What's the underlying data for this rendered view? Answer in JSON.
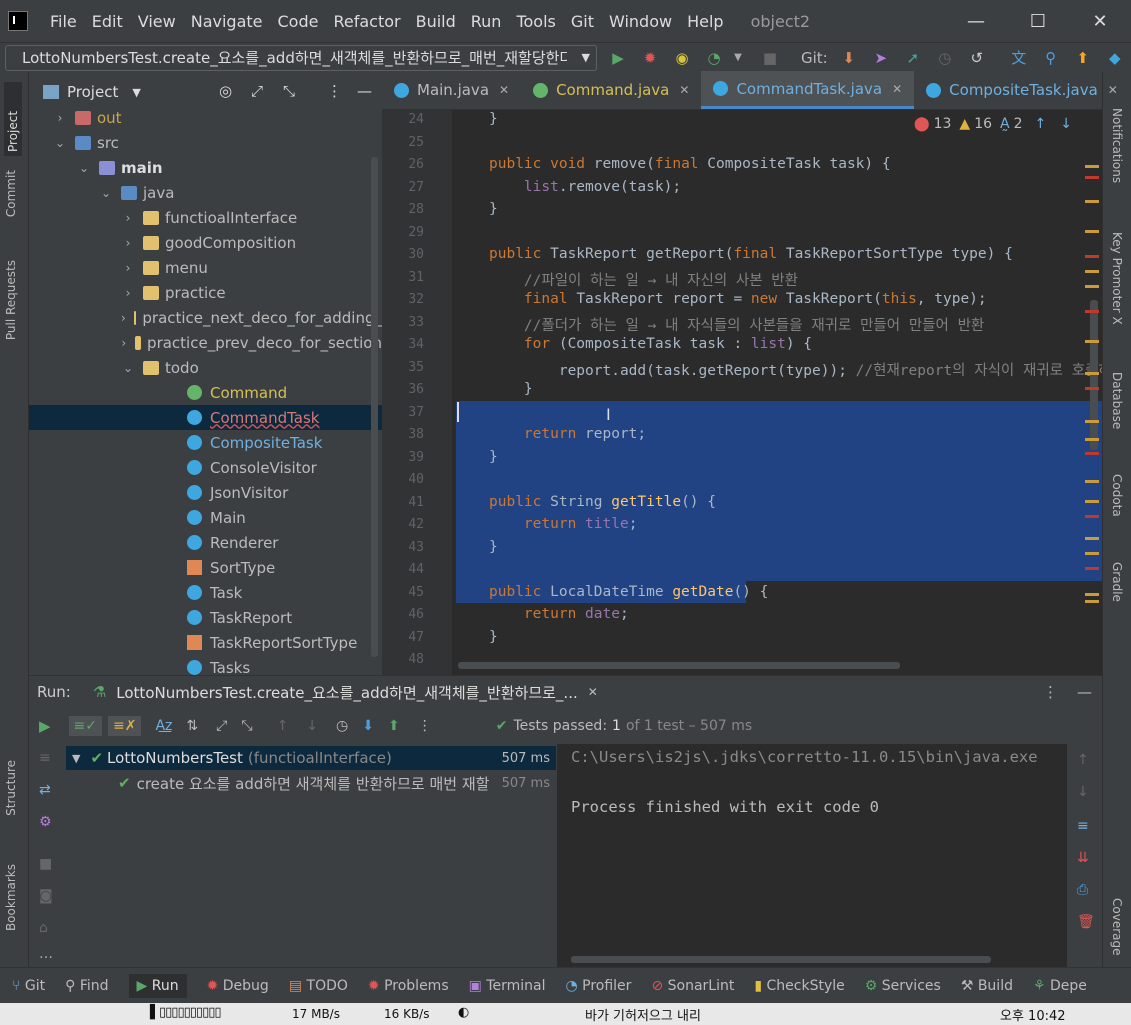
{
  "menubar": {
    "items": [
      "File",
      "Edit",
      "View",
      "Navigate",
      "Code",
      "Refactor",
      "Build",
      "Run",
      "Tools",
      "Git",
      "Window",
      "Help"
    ],
    "project": "object2"
  },
  "toolbar": {
    "run_config": "LottoNumbersTest.create_요소를_add하면_새객체를_반환하므로_매번_재할당한다",
    "git_label": "Git:"
  },
  "left_stripe": {
    "project": "Project",
    "commit": "Commit",
    "pull_requests": "Pull Requests",
    "structure": "Structure",
    "bookmarks": "Bookmarks"
  },
  "right_stripe": {
    "notifications": "Notifications",
    "key_promoter": "Key Promoter X",
    "database": "Database",
    "codota": "Codota",
    "gradle": "Gradle",
    "coverage": "Coverage"
  },
  "project_panel": {
    "title": "Project",
    "tree": [
      {
        "label": "out",
        "type": "folder-out"
      },
      {
        "label": "src",
        "type": "src"
      },
      {
        "label": "main",
        "type": "module"
      },
      {
        "label": "java",
        "type": "src"
      },
      {
        "label": "functioalInterface",
        "type": "folder"
      },
      {
        "label": "goodComposition",
        "type": "folder"
      },
      {
        "label": "menu",
        "type": "folder"
      },
      {
        "label": "practice",
        "type": "folder"
      },
      {
        "label": "practice_next_deco_for_adding_",
        "type": "folder"
      },
      {
        "label": "practice_prev_deco_for_section",
        "type": "folder"
      },
      {
        "label": "todo",
        "type": "folder"
      },
      {
        "label": "Command",
        "type": "interface"
      },
      {
        "label": "CommandTask",
        "type": "class"
      },
      {
        "label": "CompositeTask",
        "type": "class"
      },
      {
        "label": "ConsoleVisitor",
        "type": "class"
      },
      {
        "label": "JsonVisitor",
        "type": "class"
      },
      {
        "label": "Main",
        "type": "class"
      },
      {
        "label": "Renderer",
        "type": "class"
      },
      {
        "label": "SortType",
        "type": "enum"
      },
      {
        "label": "Task",
        "type": "class"
      },
      {
        "label": "TaskReport",
        "type": "class"
      },
      {
        "label": "TaskReportSortType",
        "type": "enum"
      },
      {
        "label": "Tasks",
        "type": "class"
      }
    ]
  },
  "editor": {
    "tabs": [
      {
        "label": "Main.java"
      },
      {
        "label": "Command.java"
      },
      {
        "label": "CommandTask.java"
      },
      {
        "label": "CompositeTask.java"
      }
    ],
    "inspections": {
      "errors": "13",
      "warnings": "16",
      "typos": "2"
    },
    "line_numbers": [
      "24",
      "25",
      "26",
      "27",
      "28",
      "29",
      "30",
      "31",
      "32",
      "33",
      "34",
      "35",
      "36",
      "37",
      "38",
      "39",
      "40",
      "41",
      "42",
      "43",
      "44",
      "45",
      "46",
      "47",
      "48"
    ]
  },
  "run_panel": {
    "label": "Run:",
    "tab": "LottoNumbersTest.create_요소를_add하면_새객체를_반환하므로_...",
    "tests_passed": "Tests passed:",
    "tests_count": "1",
    "tests_detail": "of 1 test – 507 ms",
    "tree": [
      {
        "label": "LottoNumbersTest",
        "sub": "(functioalInterface)",
        "time": "507 ms"
      },
      {
        "label": "create 요소를 add하면 새객체를 반환하므로 매번 재할",
        "sub": "",
        "time": "507 ms"
      }
    ],
    "console": [
      "C:\\Users\\is2js\\.jdks\\corretto-11.0.15\\bin\\java.exe",
      "",
      "Process finished with exit code 0"
    ]
  },
  "bottom_bar": [
    "Git",
    "Find",
    "Run",
    "Debug",
    "TODO",
    "Problems",
    "Terminal",
    "Profiler",
    "SonarLint",
    "CheckStyle",
    "Services",
    "Build",
    "Depe"
  ],
  "taskbar": {
    "net1": "17 MB/s",
    "net2": "16 KB/s",
    "ime": "바가 기허저으그 내리",
    "clock": "오후 10:42"
  }
}
